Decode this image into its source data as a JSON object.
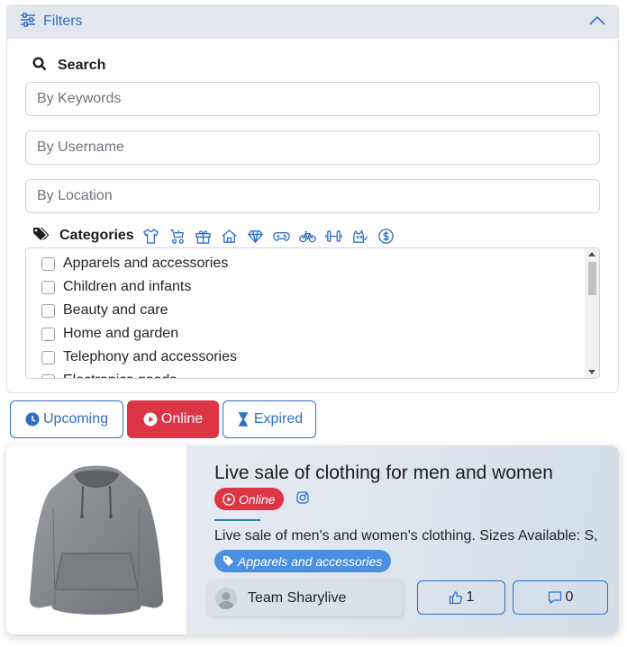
{
  "filters": {
    "title": "Filters",
    "search_label": "Search",
    "inputs": {
      "keywords_placeholder": "By Keywords",
      "username_placeholder": "By Username",
      "location_placeholder": "By Location"
    },
    "categories_label": "Categories",
    "category_icons": [
      "shirt-icon",
      "stroller-icon",
      "gift-icon",
      "home-icon",
      "diamond-icon",
      "gamepad-icon",
      "bicycle-icon",
      "dumbbell-icon",
      "pet-icon",
      "money-icon"
    ],
    "category_options": [
      "Apparels and accessories",
      "Children and infants",
      "Beauty and care",
      "Home and garden",
      "Telephony and accessories",
      "Electronics goods"
    ]
  },
  "status_tabs": {
    "upcoming": "Upcoming",
    "online": "Online",
    "expired": "Expired",
    "active": "online"
  },
  "event": {
    "title": "Live sale of clothing for men and women",
    "status_badge": "Online",
    "description": "Live sale of men's and women's clothing. Sizes Available: S,",
    "category": "Apparels and accessories",
    "host": "Team Sharylive",
    "likes": "1",
    "comments": "0"
  },
  "colors": {
    "primary": "#2f6ec5",
    "danger": "#dc3545",
    "category_badge": "#4a8fe0"
  }
}
